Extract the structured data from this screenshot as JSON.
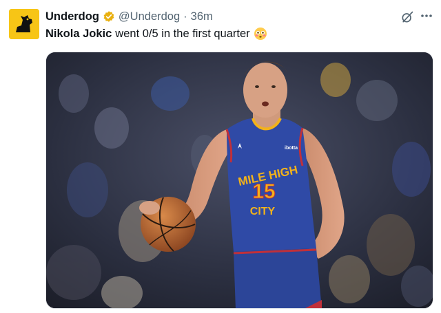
{
  "tweet": {
    "display_name": "Underdog",
    "handle": "@Underdog",
    "separator": "·",
    "timestamp": "36m",
    "text_bold": "Nikola Jokic",
    "text_rest": "went 0/5 in the first quarter",
    "emoji": "flushed-face-emoji"
  },
  "jersey": {
    "line1": "MILE HIGH",
    "number": "15",
    "line2": "CITY",
    "sponsor": "ibotta"
  },
  "icons": {
    "avatar": "underdog-dog-logo",
    "verified": "verified-badge-icon",
    "grok": "grok-icon",
    "more": "more-icon"
  },
  "colors": {
    "verified_badge": "#e9b00f",
    "avatar_bg": "#f7c516",
    "jersey_blue": "#2f4aa6",
    "jersey_gold": "#f2b21b"
  }
}
